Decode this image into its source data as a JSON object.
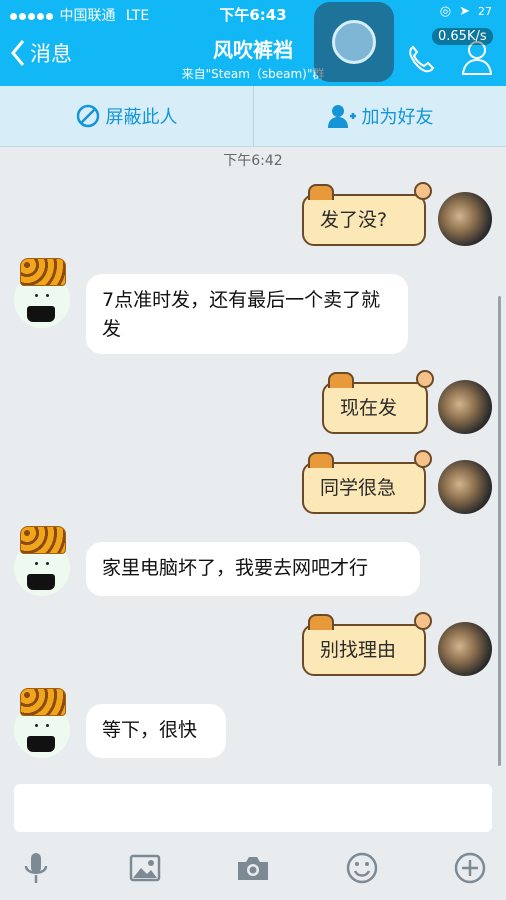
{
  "status": {
    "carrier": "中国联通",
    "network": "LTE",
    "time": "下午6:43",
    "battery_text": "27"
  },
  "header": {
    "back_label": "消息",
    "title": "风吹裤裆",
    "subtitle": "来自\"Steam（sbeam)\"群",
    "speed": "0.65K/s"
  },
  "actions": {
    "block_label": "屏蔽此人",
    "add_friend_label": "加为好友"
  },
  "timestamp": "下午6:42",
  "messages": [
    {
      "side": "right",
      "text": "发了没?"
    },
    {
      "side": "left",
      "text": "7点准时发，还有最后一个卖了就发"
    },
    {
      "side": "right",
      "text": "现在发"
    },
    {
      "side": "right",
      "text": "同学很急"
    },
    {
      "side": "left",
      "text": "家里电脑坏了，我要去网吧才行"
    },
    {
      "side": "right",
      "text": "别找理由"
    },
    {
      "side": "left",
      "text": "等下，很快"
    }
  ],
  "toolbar": {
    "icons": [
      "microphone-icon",
      "image-icon",
      "camera-icon",
      "emoji-icon",
      "plus-icon"
    ]
  },
  "colors": {
    "accent": "#12b7f5",
    "action_bar": "#d7eef9",
    "action_text": "#1395d8",
    "right_bubble": "#fbe8b6"
  }
}
